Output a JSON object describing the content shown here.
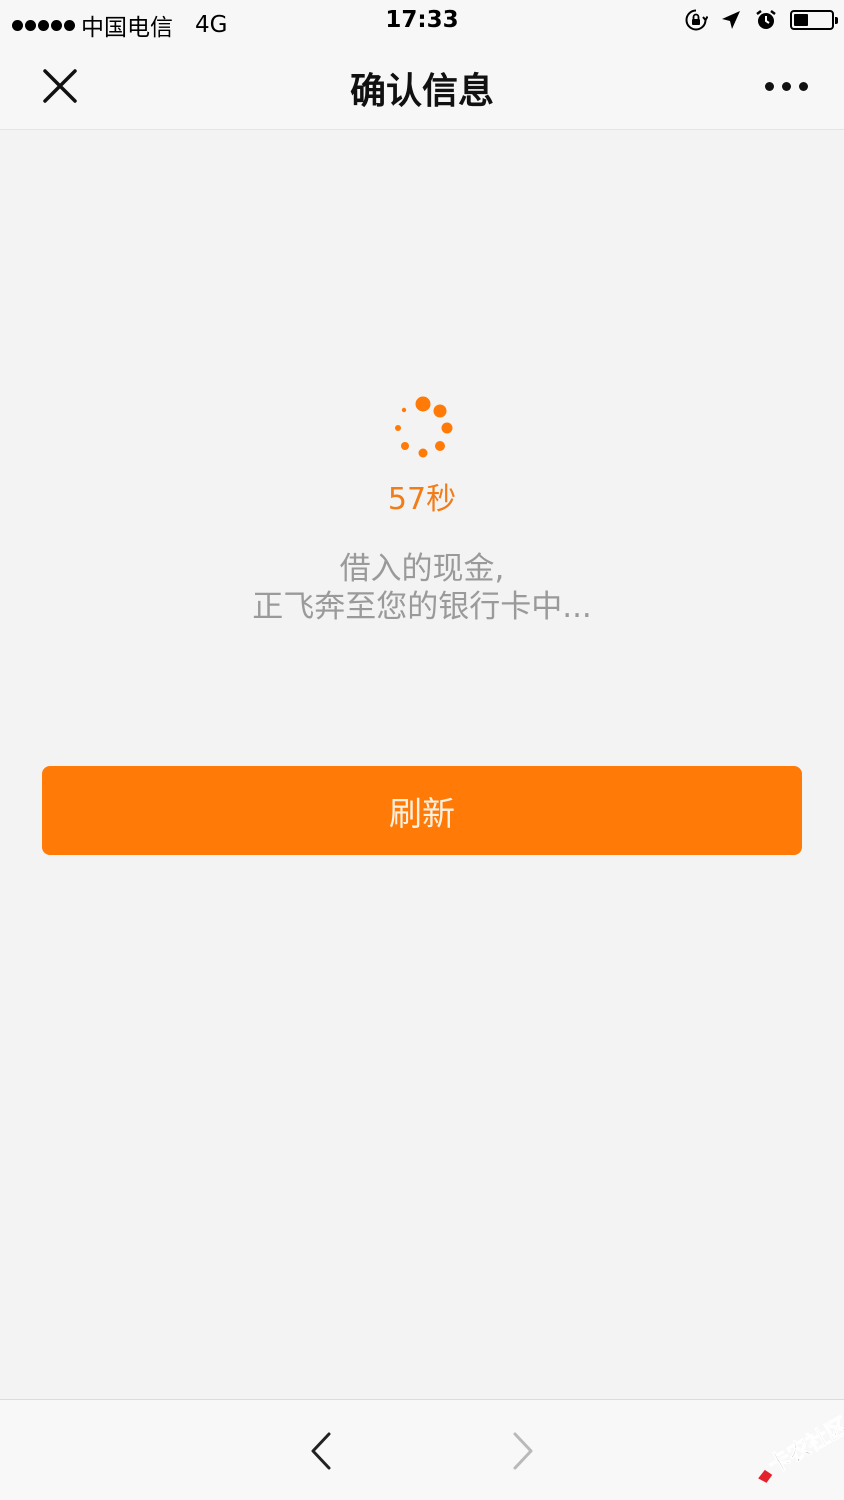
{
  "status_bar": {
    "carrier": "中国电信",
    "network": "4G",
    "time": "17:33",
    "battery_level": 0.4
  },
  "nav": {
    "title": "确认信息"
  },
  "loading": {
    "countdown": "57秒",
    "message_line1": "借入的现金,",
    "message_line2": "正飞奔至您的银行卡中..."
  },
  "actions": {
    "refresh_label": "刷新"
  },
  "watermark": {
    "text": "卡农社区"
  },
  "colors": {
    "accent": "#ff7a07",
    "countdown": "#f27c17",
    "message": "#9a9a9a",
    "background": "#f3f3f3"
  }
}
